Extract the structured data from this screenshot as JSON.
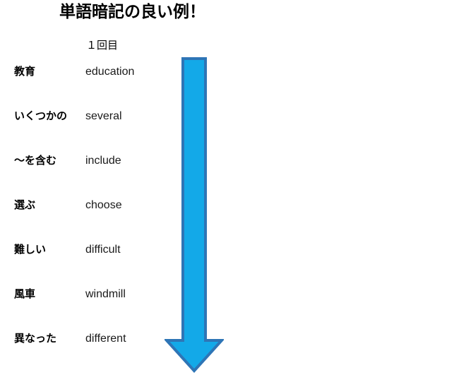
{
  "slide": {
    "title": "単語暗記の良い例！",
    "column_header": "１回目",
    "background_color": "#ffffff"
  },
  "word_list": [
    {
      "japanese": "教育",
      "english": "education"
    },
    {
      "japanese": "いくつかの",
      "english": "several"
    },
    {
      "japanese": "〜を含む",
      "english": "include"
    },
    {
      "japanese": "選ぶ",
      "english": "choose"
    },
    {
      "japanese": "難しい",
      "english": "difficult"
    },
    {
      "japanese": "風車",
      "english": "windmill"
    },
    {
      "japanese": "異なった",
      "english": "different"
    }
  ],
  "arrow": {
    "direction": "down",
    "fill_color": "#13a9e8",
    "border_color": "#2e75b6"
  }
}
